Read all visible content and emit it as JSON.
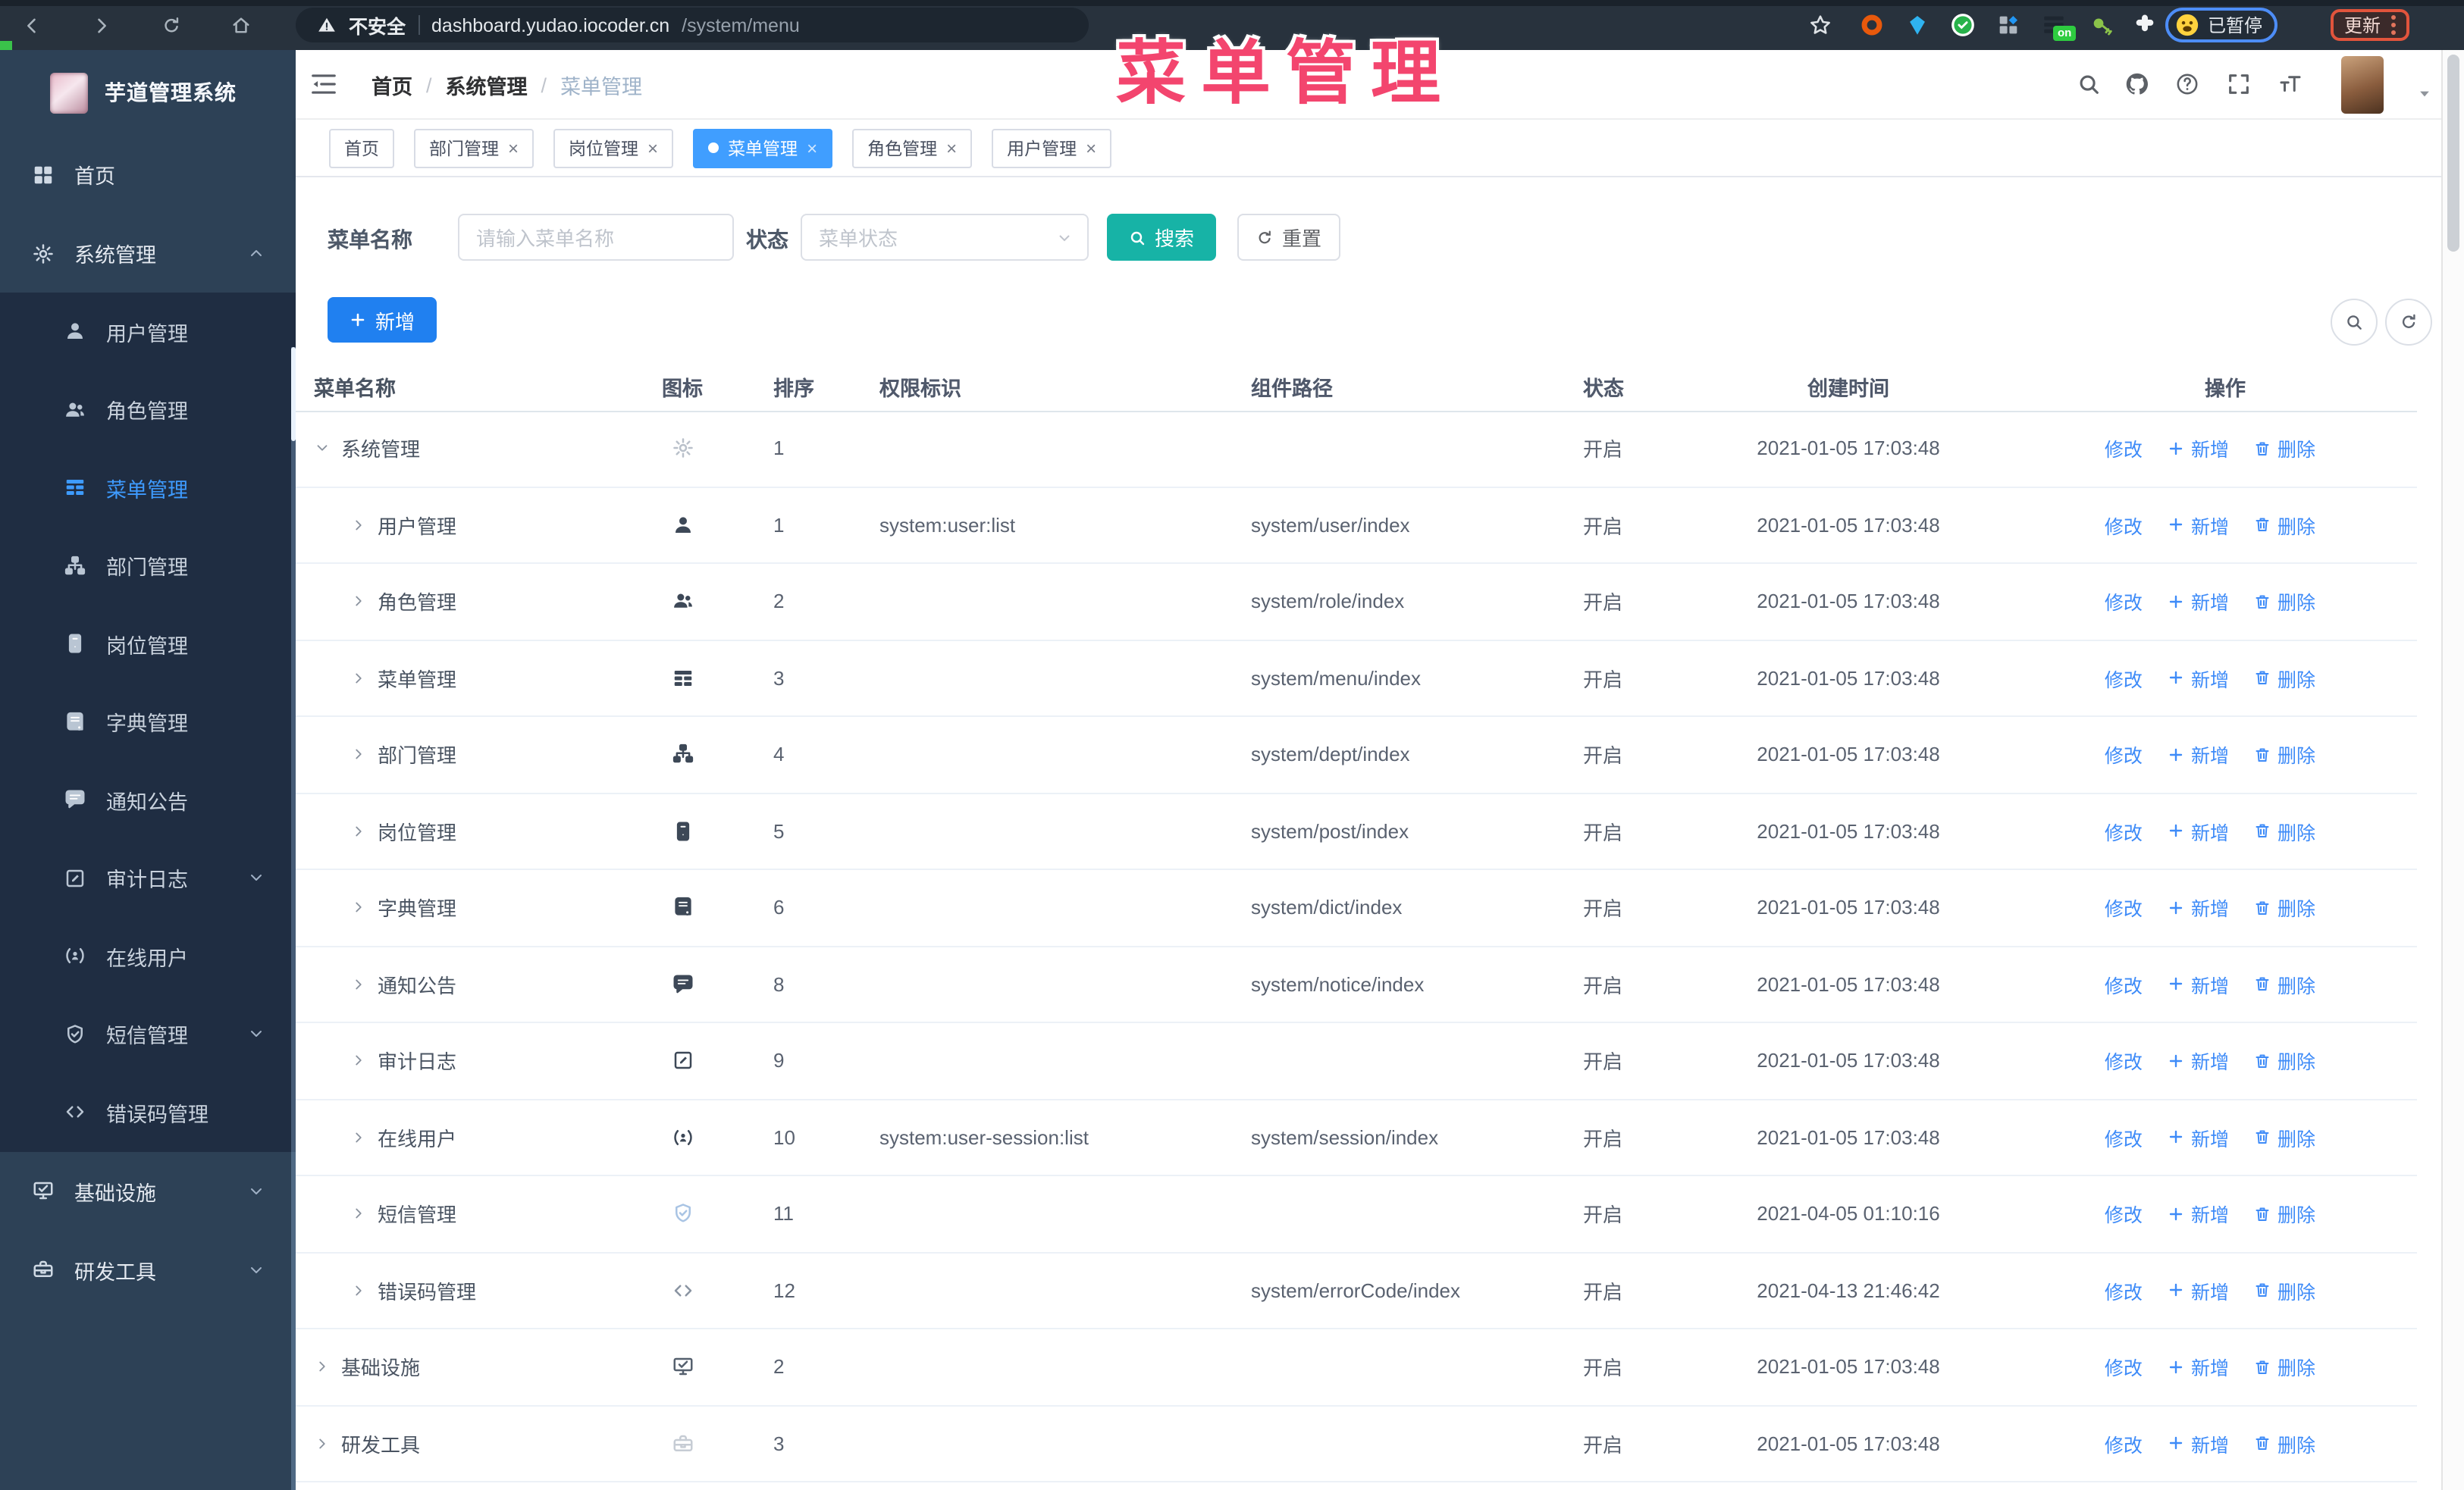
{
  "browser": {
    "security_label": "不安全",
    "url_host": "dashboard.yudao.iocoder.cn",
    "url_path": "/system/menu",
    "ext_on_badge": "on",
    "paused_badge": "已暂停",
    "update_badge": "更新"
  },
  "overlay_title": "菜单管理",
  "sidebar": {
    "logo_title": "芋道管理系统",
    "items": [
      {
        "id": "home",
        "label": "首页",
        "level": 0,
        "icon": "dashboard-icon"
      },
      {
        "id": "system",
        "label": "系统管理",
        "level": 0,
        "icon": "gear-icon",
        "expanded": true
      },
      {
        "id": "user",
        "label": "用户管理",
        "level": 1,
        "icon": "user-icon"
      },
      {
        "id": "role",
        "label": "角色管理",
        "level": 1,
        "icon": "users-icon"
      },
      {
        "id": "menu",
        "label": "菜单管理",
        "level": 1,
        "icon": "menu-tree-icon",
        "active": true
      },
      {
        "id": "dept",
        "label": "部门管理",
        "level": 1,
        "icon": "org-tree-icon"
      },
      {
        "id": "post",
        "label": "岗位管理",
        "level": 1,
        "icon": "badge-icon"
      },
      {
        "id": "dict",
        "label": "字典管理",
        "level": 1,
        "icon": "dict-book-icon"
      },
      {
        "id": "notice",
        "label": "通知公告",
        "level": 1,
        "icon": "notice-icon"
      },
      {
        "id": "auditlog",
        "label": "审计日志",
        "level": 1,
        "icon": "audit-log-icon",
        "expandable": true
      },
      {
        "id": "online",
        "label": "在线用户",
        "level": 1,
        "icon": "online-user-icon"
      },
      {
        "id": "sms",
        "label": "短信管理",
        "level": 1,
        "icon": "sms-shield-icon",
        "expandable": true
      },
      {
        "id": "errcode",
        "label": "错误码管理",
        "level": 1,
        "icon": "error-code-icon"
      },
      {
        "id": "infra",
        "label": "基础设施",
        "level": 0,
        "icon": "infra-icon",
        "expandable": true
      },
      {
        "id": "devtool",
        "label": "研发工具",
        "level": 0,
        "icon": "devtool-icon",
        "expandable": true
      }
    ]
  },
  "navbar": {
    "breadcrumb": [
      {
        "id": "home",
        "label": "首页"
      },
      {
        "id": "system",
        "label": "系统管理"
      },
      {
        "id": "menu",
        "label": "菜单管理"
      }
    ]
  },
  "tabs": [
    {
      "id": "home",
      "label": "首页",
      "closable": false,
      "active": false
    },
    {
      "id": "dept",
      "label": "部门管理",
      "closable": true,
      "active": false
    },
    {
      "id": "post",
      "label": "岗位管理",
      "closable": true,
      "active": false
    },
    {
      "id": "menu",
      "label": "菜单管理",
      "closable": true,
      "active": true
    },
    {
      "id": "role",
      "label": "角色管理",
      "closable": true,
      "active": false
    },
    {
      "id": "user",
      "label": "用户管理",
      "closable": true,
      "active": false
    }
  ],
  "filters": {
    "name_label": "菜单名称",
    "name_placeholder": "请输入菜单名称",
    "status_label": "状态",
    "status_placeholder": "菜单状态",
    "search_label": "搜索",
    "reset_label": "重置"
  },
  "toolbar": {
    "add_label": "新增"
  },
  "table": {
    "columns": [
      "菜单名称",
      "图标",
      "排序",
      "权限标识",
      "组件路径",
      "状态",
      "创建时间",
      "操作"
    ],
    "ops": [
      {
        "id": "edit",
        "label": "修改",
        "icon": "edit-icon"
      },
      {
        "id": "add",
        "label": "新增",
        "icon": "plus-icon"
      },
      {
        "id": "delete",
        "label": "删除",
        "icon": "trash-icon"
      }
    ],
    "rows": [
      {
        "id": "system",
        "name": "系统管理",
        "level": 0,
        "caret": "down",
        "icon": "gear-icon",
        "icon_color": "#b9c0ca",
        "sort": "1",
        "perm": "",
        "path": "",
        "status": "开启",
        "time": "2021-01-05 17:03:48"
      },
      {
        "id": "user",
        "name": "用户管理",
        "level": 1,
        "caret": "right",
        "icon": "user-icon",
        "icon_color": "#3d4857",
        "sort": "1",
        "perm": "system:user:list",
        "path": "system/user/index",
        "status": "开启",
        "time": "2021-01-05 17:03:48"
      },
      {
        "id": "role",
        "name": "角色管理",
        "level": 1,
        "caret": "right",
        "icon": "users-icon",
        "icon_color": "#3d4857",
        "sort": "2",
        "perm": "",
        "path": "system/role/index",
        "status": "开启",
        "time": "2021-01-05 17:03:48"
      },
      {
        "id": "menu",
        "name": "菜单管理",
        "level": 1,
        "caret": "right",
        "icon": "menu-tree-icon",
        "icon_color": "#3d4857",
        "sort": "3",
        "perm": "",
        "path": "system/menu/index",
        "status": "开启",
        "time": "2021-01-05 17:03:48"
      },
      {
        "id": "dept",
        "name": "部门管理",
        "level": 1,
        "caret": "right",
        "icon": "org-tree-icon",
        "icon_color": "#3d4857",
        "sort": "4",
        "perm": "",
        "path": "system/dept/index",
        "status": "开启",
        "time": "2021-01-05 17:03:48"
      },
      {
        "id": "post",
        "name": "岗位管理",
        "level": 1,
        "caret": "right",
        "icon": "badge-icon",
        "icon_color": "#3d4857",
        "sort": "5",
        "perm": "",
        "path": "system/post/index",
        "status": "开启",
        "time": "2021-01-05 17:03:48"
      },
      {
        "id": "dict",
        "name": "字典管理",
        "level": 1,
        "caret": "right",
        "icon": "dict-book-icon",
        "icon_color": "#3d4857",
        "sort": "6",
        "perm": "",
        "path": "system/dict/index",
        "status": "开启",
        "time": "2021-01-05 17:03:48"
      },
      {
        "id": "notice",
        "name": "通知公告",
        "level": 1,
        "caret": "right",
        "icon": "notice-icon",
        "icon_color": "#3d4857",
        "sort": "8",
        "perm": "",
        "path": "system/notice/index",
        "status": "开启",
        "time": "2021-01-05 17:03:48"
      },
      {
        "id": "auditlog",
        "name": "审计日志",
        "level": 1,
        "caret": "right",
        "icon": "audit-log-icon",
        "icon_color": "#3d4857",
        "sort": "9",
        "perm": "",
        "path": "",
        "status": "开启",
        "time": "2021-01-05 17:03:48"
      },
      {
        "id": "online",
        "name": "在线用户",
        "level": 1,
        "caret": "right",
        "icon": "online-user-icon",
        "icon_color": "#3d4857",
        "sort": "10",
        "perm": "system:user-session:list",
        "path": "system/session/index",
        "status": "开启",
        "time": "2021-01-05 17:03:48"
      },
      {
        "id": "sms",
        "name": "短信管理",
        "level": 1,
        "caret": "right",
        "icon": "sms-shield-icon",
        "icon_color": "#a9c4e4",
        "sort": "11",
        "perm": "",
        "path": "",
        "status": "开启",
        "time": "2021-04-05 01:10:16"
      },
      {
        "id": "errcode",
        "name": "错误码管理",
        "level": 1,
        "caret": "right",
        "icon": "error-code-icon",
        "icon_color": "#8a94a2",
        "sort": "12",
        "perm": "",
        "path": "system/errorCode/index",
        "status": "开启",
        "time": "2021-04-13 21:46:42"
      },
      {
        "id": "infra",
        "name": "基础设施",
        "level": 0,
        "caret": "right",
        "icon": "infra-icon",
        "icon_color": "#55606e",
        "sort": "2",
        "perm": "",
        "path": "",
        "status": "开启",
        "time": "2021-01-05 17:03:48"
      },
      {
        "id": "devtool",
        "name": "研发工具",
        "level": 0,
        "caret": "right",
        "icon": "devtool-icon",
        "icon_color": "#c6ccd4",
        "sort": "3",
        "perm": "",
        "path": "",
        "status": "开启",
        "time": "2021-01-05 17:03:48"
      }
    ]
  }
}
